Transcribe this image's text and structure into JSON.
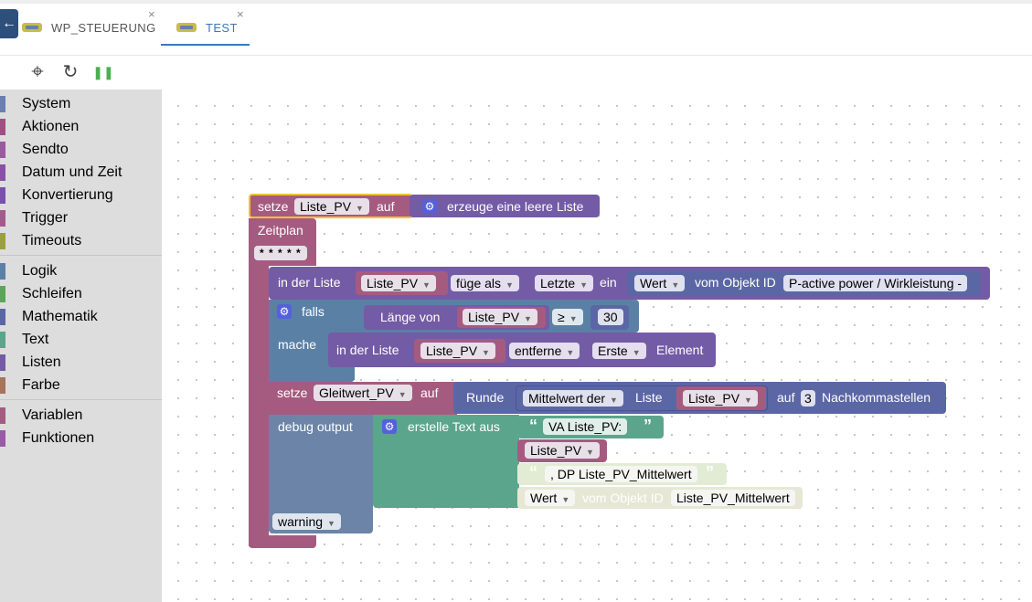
{
  "tabs": {
    "back_icon": "←",
    "items": [
      {
        "label": "WP_STEUERUNG",
        "close": "×"
      },
      {
        "label": "TEST",
        "close": "×"
      }
    ]
  },
  "toolbar": {
    "icons": [
      "target-icon",
      "refresh-icon",
      "pause-icon"
    ],
    "glyphs": {
      "target": "⌖",
      "refresh": "↻",
      "pause": "❚❚"
    }
  },
  "sidebar": {
    "group1": [
      {
        "label": "System",
        "color": "#6b7fb0"
      },
      {
        "label": "Aktionen",
        "color": "#a05080"
      },
      {
        "label": "Sendto",
        "color": "#9a5aa0"
      },
      {
        "label": "Datum und Zeit",
        "color": "#8a50a8"
      },
      {
        "label": "Konvertierung",
        "color": "#7a4fb0"
      },
      {
        "label": "Trigger",
        "color": "#a55a8c"
      },
      {
        "label": "Timeouts",
        "color": "#9aa040"
      }
    ],
    "group2": [
      {
        "label": "Logik",
        "color": "#5b80a5"
      },
      {
        "label": "Schleifen",
        "color": "#5ba55b"
      },
      {
        "label": "Mathematik",
        "color": "#5b67a5"
      },
      {
        "label": "Text",
        "color": "#5ba58c"
      },
      {
        "label": "Listen",
        "color": "#745ba5"
      },
      {
        "label": "Farbe",
        "color": "#a5745b"
      }
    ],
    "group3": [
      {
        "label": "Variablen",
        "color": "#a55b80"
      },
      {
        "label": "Funktionen",
        "color": "#995ba5"
      }
    ]
  },
  "blocks": {
    "b1": {
      "setze": "setze",
      "var": "Liste_PV",
      "auf": "auf",
      "create": "erzeuge eine leere Liste"
    },
    "zeitplan": {
      "label": "Zeitplan",
      "cron": "* * * * *"
    },
    "b2": {
      "in_list": "in der Liste",
      "var": "Liste_PV",
      "insert": "füge als",
      "pos": "Letzte",
      "ein": "ein",
      "wert": "Wert",
      "vom": "vom Objekt ID",
      "obj": "P-active power / Wirkleistung -"
    },
    "b3": {
      "falls": "falls",
      "laenge": "Länge von",
      "var": "Liste_PV",
      "op": "≥",
      "num": "30",
      "mache": "mache"
    },
    "b4": {
      "in_list": "in der Liste",
      "var": "Liste_PV",
      "action": "entferne",
      "pos": "Erste",
      "element": "Element"
    },
    "b5": {
      "setze": "setze",
      "var": "Gleitwert_PV",
      "auf": "auf",
      "runde": "Runde",
      "mittel": "Mittelwert der",
      "liste": "Liste",
      "var2": "Liste_PV",
      "auf2": "auf",
      "num": "3",
      "nach": "Nachkommastellen"
    },
    "b6": {
      "debug": "debug output",
      "create_text": "erstelle Text aus",
      "q_open": "“",
      "q_close": "”",
      "t1": "VA Liste_PV:",
      "var": "Liste_PV",
      "t2": ", DP Liste_PV_Mittelwert",
      "wert": "Wert",
      "vom": "vom Objekt ID",
      "obj": "Liste_PV_Mittelwert",
      "level": "warning"
    }
  },
  "colors": {
    "variables": "#a55b80",
    "lists": "#745ba5",
    "logic": "#5b80a5",
    "math": "#5b67a5",
    "text": "#5ba58c",
    "highlight": "#f1c232"
  }
}
